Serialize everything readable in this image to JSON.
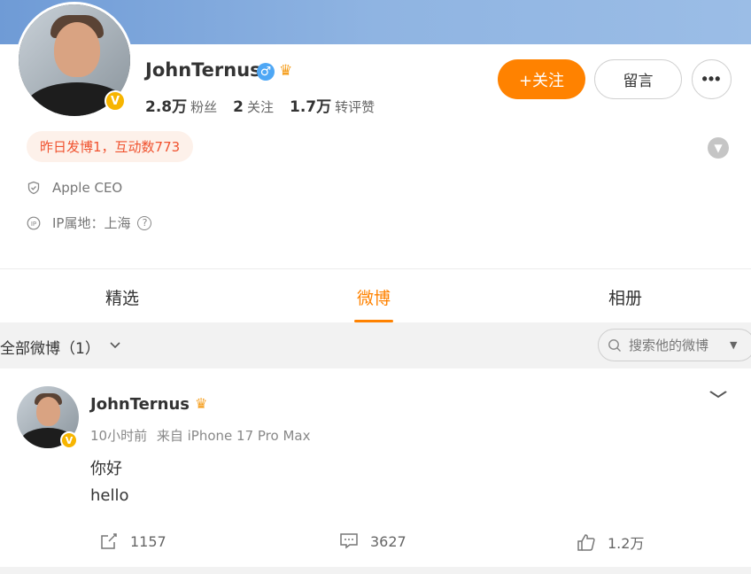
{
  "profile": {
    "name": "JohnTernus",
    "verified_badge": "V",
    "gender_icon": "male-icon",
    "vip_icon": "crown-icon",
    "stats": [
      {
        "num": "2.8万",
        "label": "粉丝"
      },
      {
        "num": "2",
        "label": "关注"
      },
      {
        "num": "1.7万",
        "label": "转评赞"
      }
    ],
    "follow_label": "+关注",
    "message_label": "留言",
    "more_label": "•••",
    "activity_text": "昨日发博1，互动数773",
    "title_text": "Apple CEO",
    "ip_text": "IP属地：上海",
    "help_glyph": "?"
  },
  "tabs": [
    {
      "label": "精选"
    },
    {
      "label": "微博"
    },
    {
      "label": "相册"
    }
  ],
  "active_tab": "微博",
  "filter": {
    "label": "全部微博（1）",
    "search_placeholder": "搜索他的微博"
  },
  "post": {
    "author": "JohnTernus",
    "time": "10小时前",
    "source": "来自 iPhone 17 Pro Max",
    "lines": [
      "你好",
      "hello"
    ],
    "reposts": "1157",
    "comments": "3627",
    "likes": "1.2万"
  },
  "colors": {
    "accent": "#ff8200",
    "activity_text": "#f0522f",
    "activity_bg": "#fdf1ea",
    "verified": "#f7b500",
    "male": "#4ea7f5"
  }
}
